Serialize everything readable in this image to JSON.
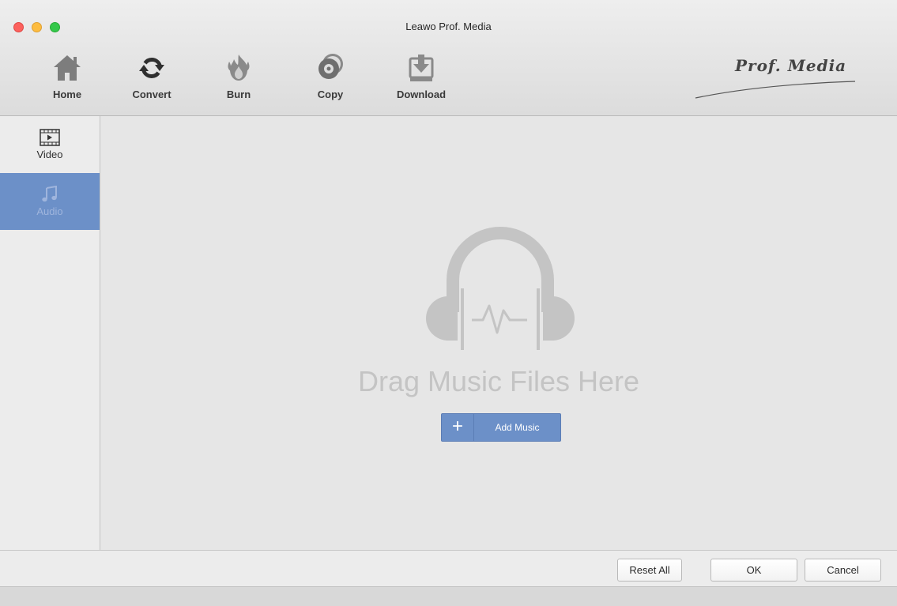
{
  "window": {
    "title": "Leawo Prof. Media"
  },
  "toolbar": {
    "items": [
      {
        "label": "Home",
        "icon": "home-icon"
      },
      {
        "label": "Convert",
        "icon": "convert-icon"
      },
      {
        "label": "Burn",
        "icon": "burn-icon"
      },
      {
        "label": "Copy",
        "icon": "copy-icon"
      },
      {
        "label": "Download",
        "icon": "download-icon"
      }
    ],
    "brand": "Prof. Media"
  },
  "sidebar": {
    "items": [
      {
        "label": "Video",
        "icon": "video-icon",
        "active": false
      },
      {
        "label": "Audio",
        "icon": "music-note-icon",
        "active": true
      }
    ]
  },
  "main": {
    "drop_text": "Drag Music Files Here",
    "drop_icon": "headphones-icon",
    "add_button": {
      "plus": "+",
      "label": "Add Music"
    }
  },
  "footer": {
    "reset_label": "Reset All",
    "ok_label": "OK",
    "cancel_label": "Cancel"
  },
  "colors": {
    "accent": "#6c90c8",
    "accent_text": "#9fb5dd",
    "placeholder_gray": "#c4c4c4"
  }
}
